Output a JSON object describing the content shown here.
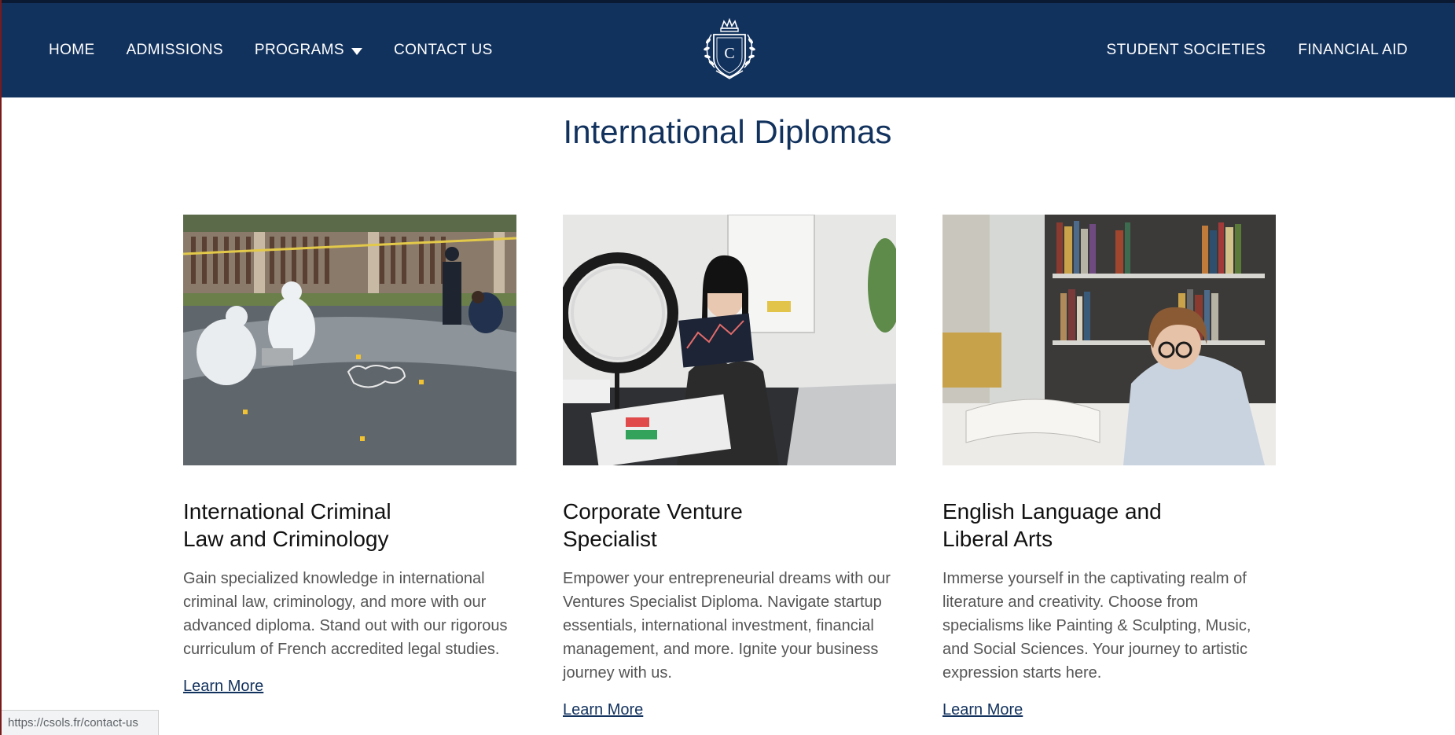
{
  "nav": {
    "left": [
      "HOME",
      "ADMISSIONS",
      "PROGRAMS",
      "CONTACT US"
    ],
    "right": [
      "STUDENT SOCIETIES",
      "FINANCIAL AID"
    ],
    "logo_letter": "C"
  },
  "page_title": "International Diplomas",
  "cards": [
    {
      "title": "International Criminal\nLaw and Criminology",
      "description": "Gain specialized knowledge in international criminal law, criminology, and more with our advanced diploma. Stand out with our rigorous curriculum of French accredited legal studies.",
      "link": "Learn More",
      "image": "crime-scene-investigation-photo"
    },
    {
      "title": "Corporate Venture\nSpecialist",
      "description": "Empower your entrepreneurial dreams with our Ventures Specialist Diploma. Navigate startup essentials, international investment, financial management, and more. Ignite your business journey with us.",
      "link": "Learn More",
      "image": "woman-presenting-charts-photo"
    },
    {
      "title": "English Language and\nLiberal Arts",
      "description": "Immerse yourself in the captivating realm of literature and creativity. Choose from specialisms like Painting & Sculpting, Music, and Social Sciences. Your journey to artistic expression starts here.",
      "link": "Learn More",
      "image": "student-reading-library-photo"
    }
  ],
  "status_url": "https://csols.fr/contact-us",
  "colors": {
    "navbar": "#12325e",
    "title": "#12325e",
    "link": "#12325e"
  }
}
